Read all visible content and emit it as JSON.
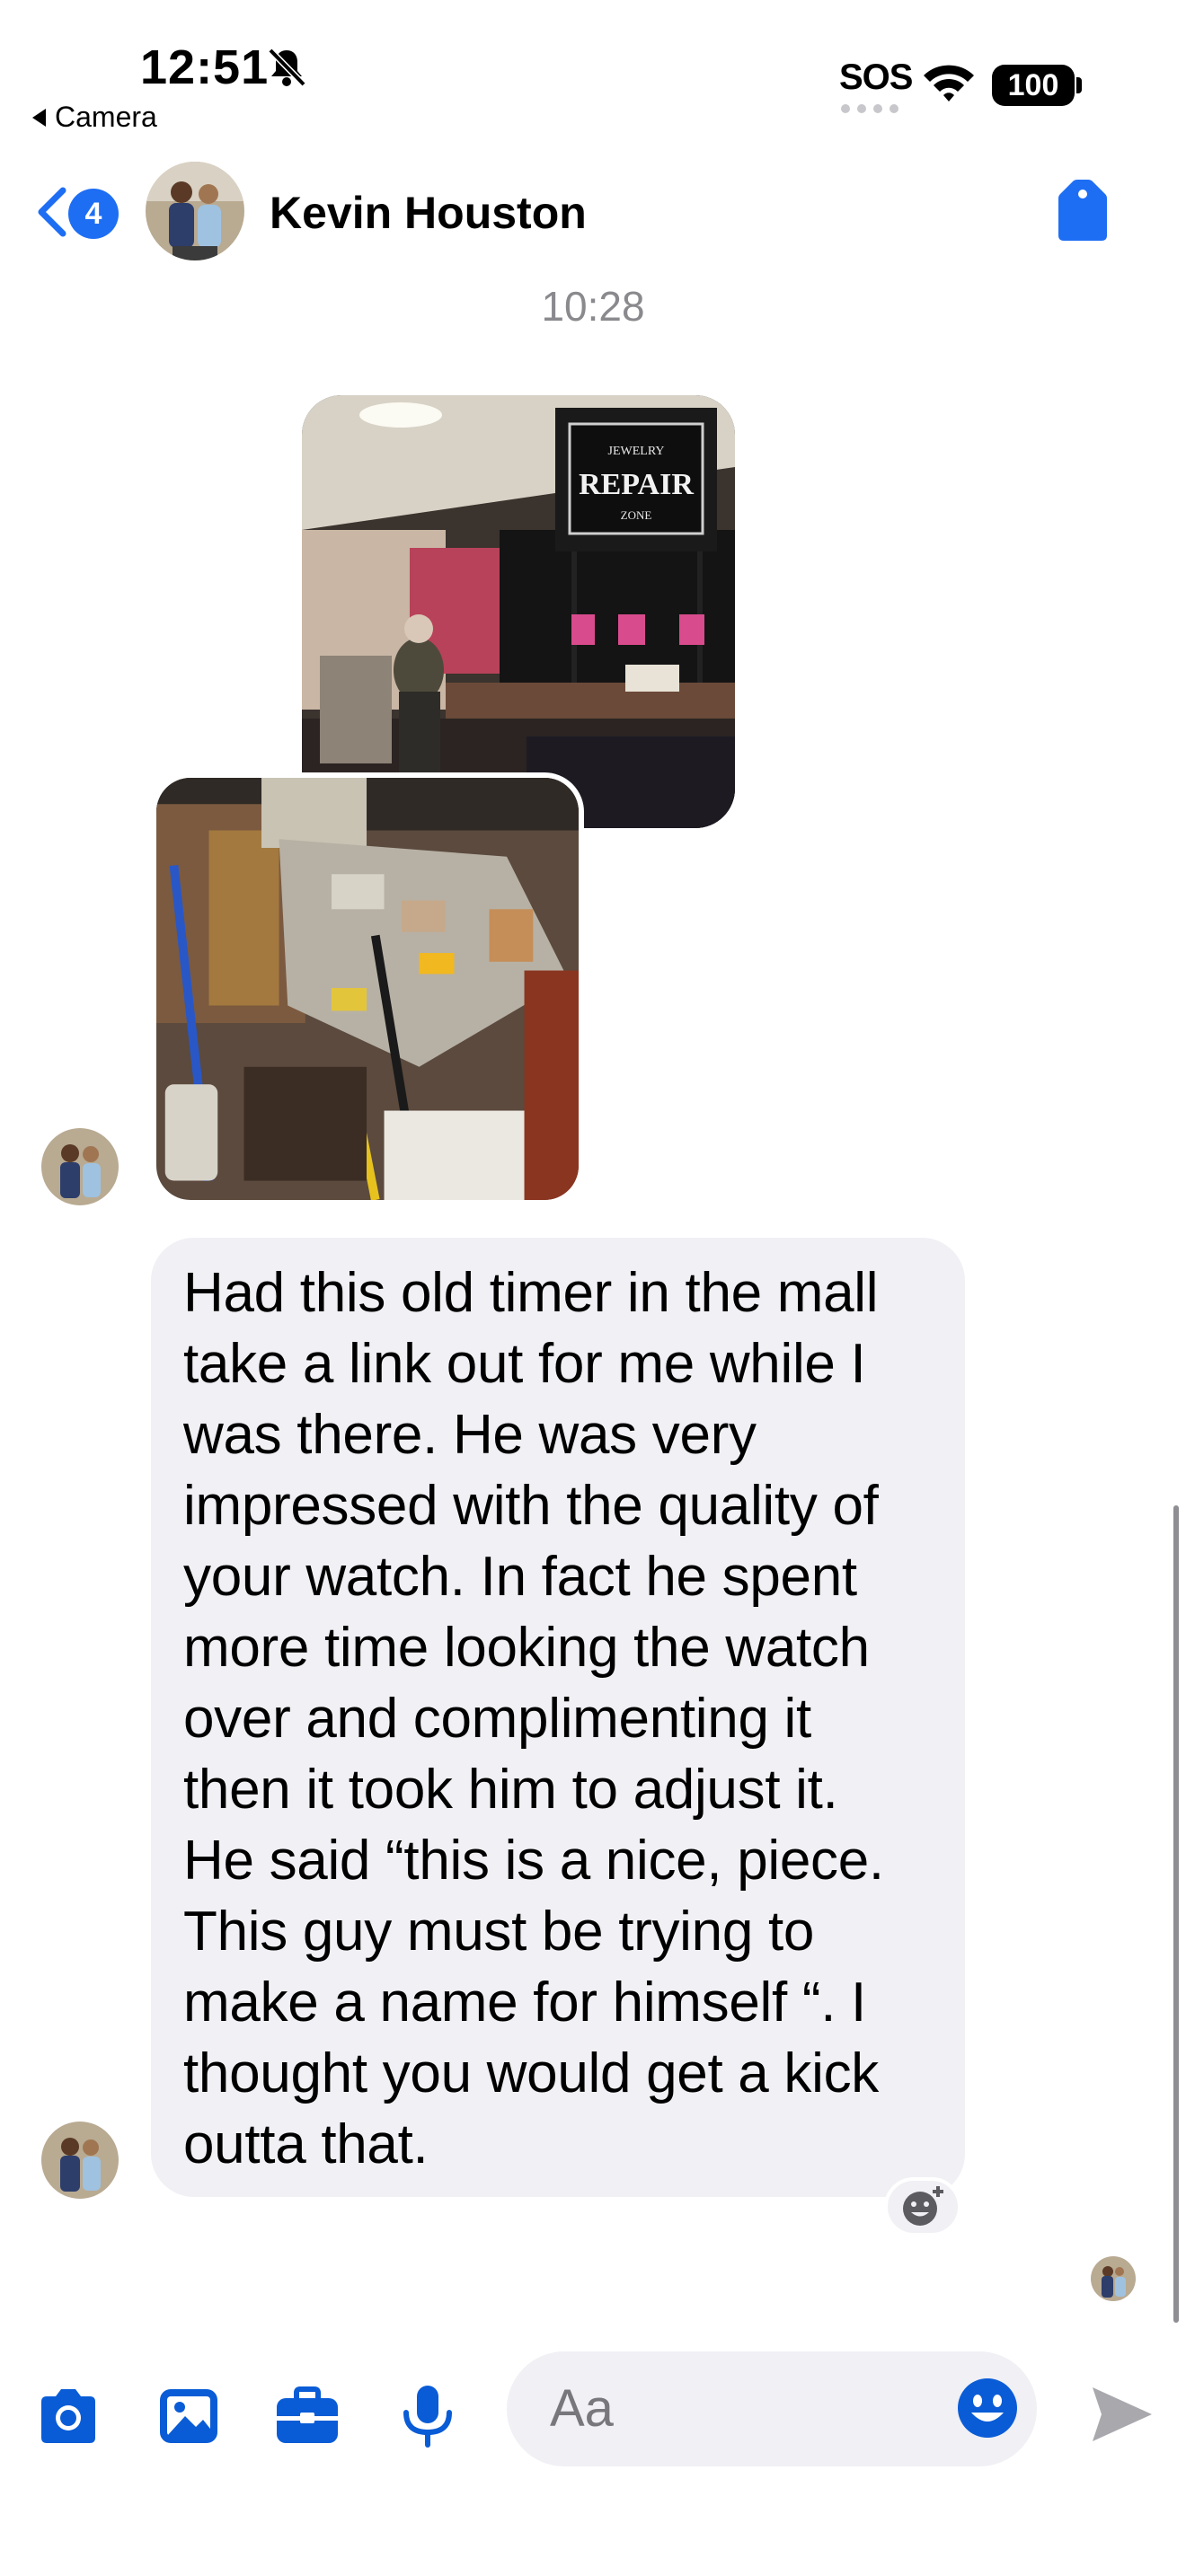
{
  "status_bar": {
    "time": "12:51",
    "back_app_label": "Camera",
    "sos_label": "SOS",
    "battery_level": "100"
  },
  "header": {
    "unread_count": "4",
    "contact_name": "Kevin Houston"
  },
  "conversation": {
    "timestamp": "10:28",
    "message_text": "Had this old timer in the mall\ntake a link out for me while I\nwas there. He was very\nimpressed with the quality of\nyour watch. In fact he spent\nmore time looking the watch\nover and complimenting it\nthen it took him to adjust it.\nHe said “this is a nice, piece.\nThis guy must be trying to\nmake a name for himself “. I\nthought you would get a kick\noutta that.",
    "photo_sign_text": {
      "top": "JEWELRY",
      "main": "REPAIR",
      "bottom": "ZONE"
    }
  },
  "composer": {
    "placeholder": "Aa"
  },
  "colors": {
    "accent": "#1e6ef4",
    "icon_blue": "#0a5cd6",
    "bubble_bg": "#f0f0f5",
    "timestamp_gray": "#8a8a8e"
  },
  "icons": [
    "bell-slash-icon",
    "wifi-icon",
    "battery-icon",
    "back-chevron-icon",
    "tag-icon",
    "camera-icon",
    "gallery-icon",
    "briefcase-icon",
    "microphone-icon",
    "emoji-icon",
    "send-icon",
    "add-reaction-icon"
  ]
}
